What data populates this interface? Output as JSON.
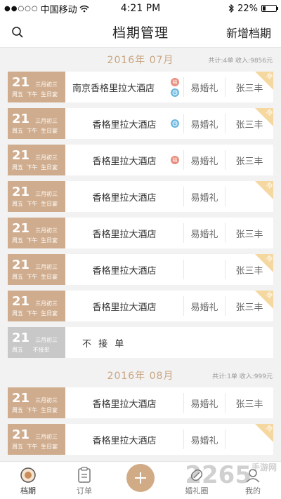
{
  "status": {
    "carrier": "中国移动",
    "time": "4:21 PM",
    "battery": "22%",
    "battery_level": 0.22
  },
  "nav": {
    "title": "档期管理",
    "right_label": "新增档期"
  },
  "months": [
    {
      "title": "2016年 07月",
      "stats": "共计:4单  收入:9856元"
    },
    {
      "title": "2016年 08月",
      "stats": "共计:1单  收入:999元"
    }
  ],
  "rows": [
    {
      "day": "21",
      "lunar": "三月初三",
      "week": "周五",
      "slot": "下午 生日宴",
      "hotel": "南京香格里拉大酒店",
      "col1": "易婚礼",
      "col2": "张三丰",
      "corner": "预"
    },
    {
      "day": "21",
      "lunar": "三月初三",
      "week": "周五",
      "slot": "下午 生日宴",
      "hotel": "香格里拉大酒店",
      "col1": "易婚礼",
      "col2": "张三丰",
      "corner": "预"
    },
    {
      "day": "21",
      "lunar": "三月初三",
      "week": "周五",
      "slot": "下午 生日宴",
      "hotel": "香格里拉大酒店",
      "col1": "易婚礼",
      "col2": "张三丰",
      "corner": ""
    },
    {
      "day": "21",
      "lunar": "三月初三",
      "week": "周五",
      "slot": "下午 生日宴",
      "hotel": "香格里拉大酒店",
      "col1": "易婚礼",
      "col2": "",
      "corner": "预"
    },
    {
      "day": "21",
      "lunar": "三月初三",
      "week": "周五",
      "slot": "下午 生日宴",
      "hotel": "香格里拉大酒店",
      "col1": "易婚礼",
      "col2": "张三丰",
      "corner": ""
    },
    {
      "day": "21",
      "lunar": "三月初三",
      "week": "周五",
      "slot": "下午 生日宴",
      "hotel": "香格里拉大酒店",
      "col1": "",
      "col2": "张三丰",
      "corner": "预"
    },
    {
      "day": "21",
      "lunar": "三月初三",
      "week": "周五",
      "slot": "下午 生日宴",
      "hotel": "香格里拉大酒店",
      "col1": "易婚礼",
      "col2": "张三丰",
      "corner": "预"
    },
    {
      "day": "21",
      "lunar": "三月初三",
      "week": "周五",
      "slot": "不接单",
      "hotel": "不 接 单"
    },
    {
      "day": "21",
      "lunar": "三月初三",
      "week": "周五",
      "slot": "下午 生日宴",
      "hotel": "香格里拉大酒店",
      "col1": "易婚礼",
      "col2": "张三丰",
      "corner": ""
    },
    {
      "day": "21",
      "lunar": "三月初三",
      "week": "周五",
      "slot": "下午 生日宴",
      "hotel": "香格里拉大酒店",
      "col1": "易婚礼",
      "col2": "",
      "corner": "预"
    }
  ],
  "badges": {
    "knot": "结"
  },
  "tabs": [
    {
      "label": "档期",
      "icon": "schedule-icon"
    },
    {
      "label": "订单",
      "icon": "order-icon"
    },
    {
      "label": "",
      "icon": "plus-icon"
    },
    {
      "label": "婚礼圈",
      "icon": "wedding-circle-icon"
    },
    {
      "label": "我的",
      "icon": "profile-icon"
    }
  ],
  "watermark": {
    "text": "2265",
    "sub": "手游网"
  },
  "colors": {
    "accent": "#cfac8d",
    "corner": "#f5d8a0",
    "month": "#c9a580"
  }
}
